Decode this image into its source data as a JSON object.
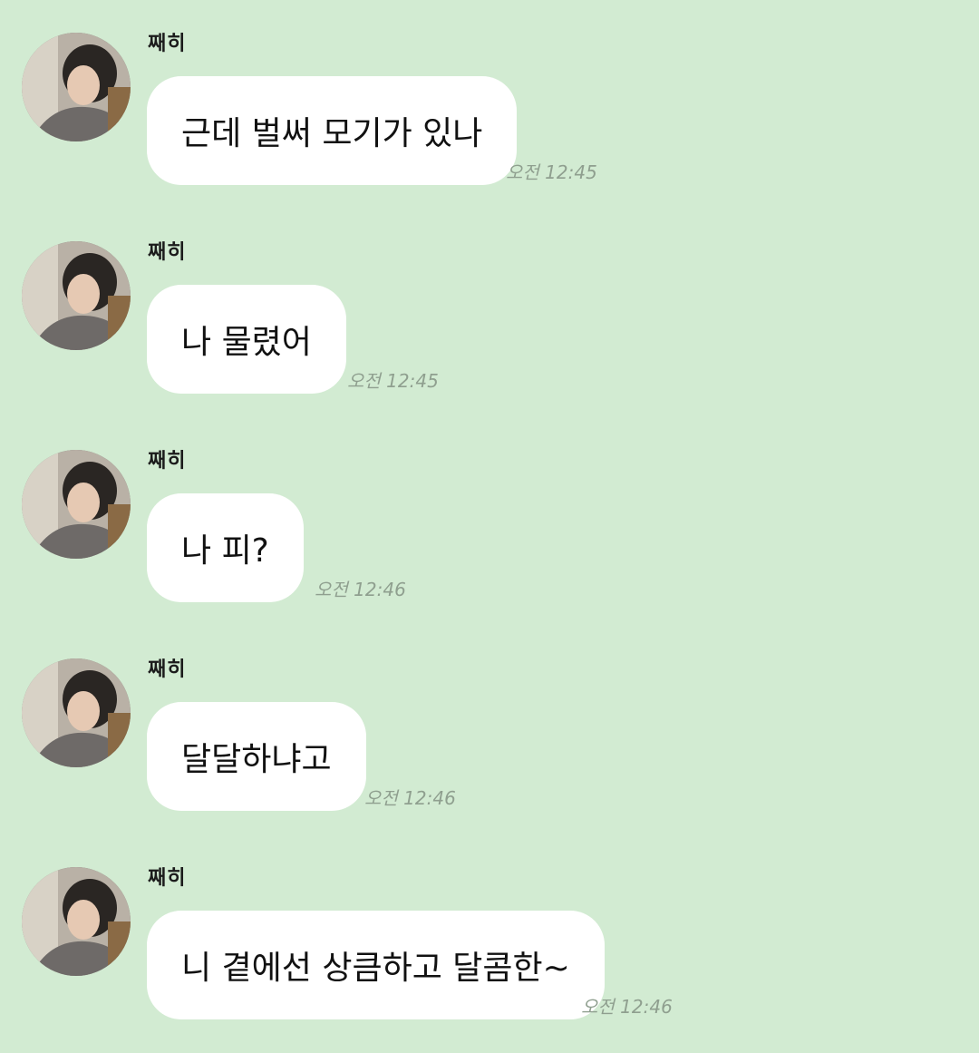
{
  "chat": {
    "messages": [
      {
        "sender": "째히",
        "text": "근데 벌써 모기가 있나",
        "time": "오전 12:45"
      },
      {
        "sender": "째히",
        "text": "나 물렸어",
        "time": "오전 12:45"
      },
      {
        "sender": "째히",
        "text": "나 피?",
        "time": "오전 12:46"
      },
      {
        "sender": "째히",
        "text": "달달하냐고",
        "time": "오전 12:46"
      },
      {
        "sender": "째히",
        "text": "니 곁에선 상큼하고 달콤한~",
        "time": "오전 12:46"
      }
    ]
  },
  "colors": {
    "background": "#d2ebd2",
    "bubble": "#ffffff",
    "timestamp": "#8f9f8f"
  },
  "icons": {
    "avatar": "profile-photo"
  }
}
